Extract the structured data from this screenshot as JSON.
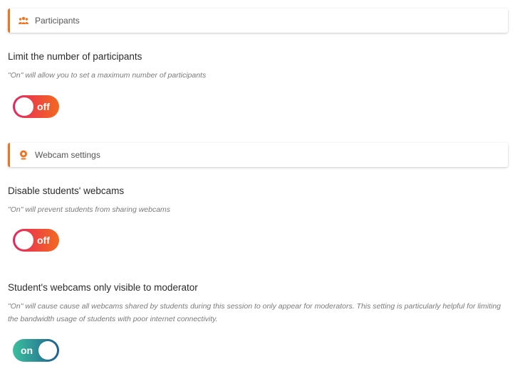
{
  "sections": {
    "participants": {
      "header": "Participants",
      "icon": "participants-icon",
      "settings": [
        {
          "title": "Limit the number of participants",
          "description": "\"On\" will allow you to set a maximum number of participants",
          "toggle": "off"
        }
      ]
    },
    "webcam": {
      "header": "Webcam settings",
      "icon": "webcam-icon",
      "settings": [
        {
          "title": "Disable students' webcams",
          "description": "\"On\" will prevent students from sharing webcams",
          "toggle": "off"
        },
        {
          "title": "Student's webcams only visible to moderator",
          "description": "\"On\" will cause cause all webcams shared by students during this session to only appear for moderators. This setting is particularly helpful for limiting the bandwidth usage of students with poor internet connectivity.",
          "toggle": "on"
        }
      ]
    }
  },
  "colors": {
    "accent": "#f0741f",
    "toggle_off_start": "#e8245f",
    "toggle_off_end": "#f26a1f",
    "toggle_on_start": "#3bbf9c",
    "toggle_on_end": "#1f5f8f"
  }
}
